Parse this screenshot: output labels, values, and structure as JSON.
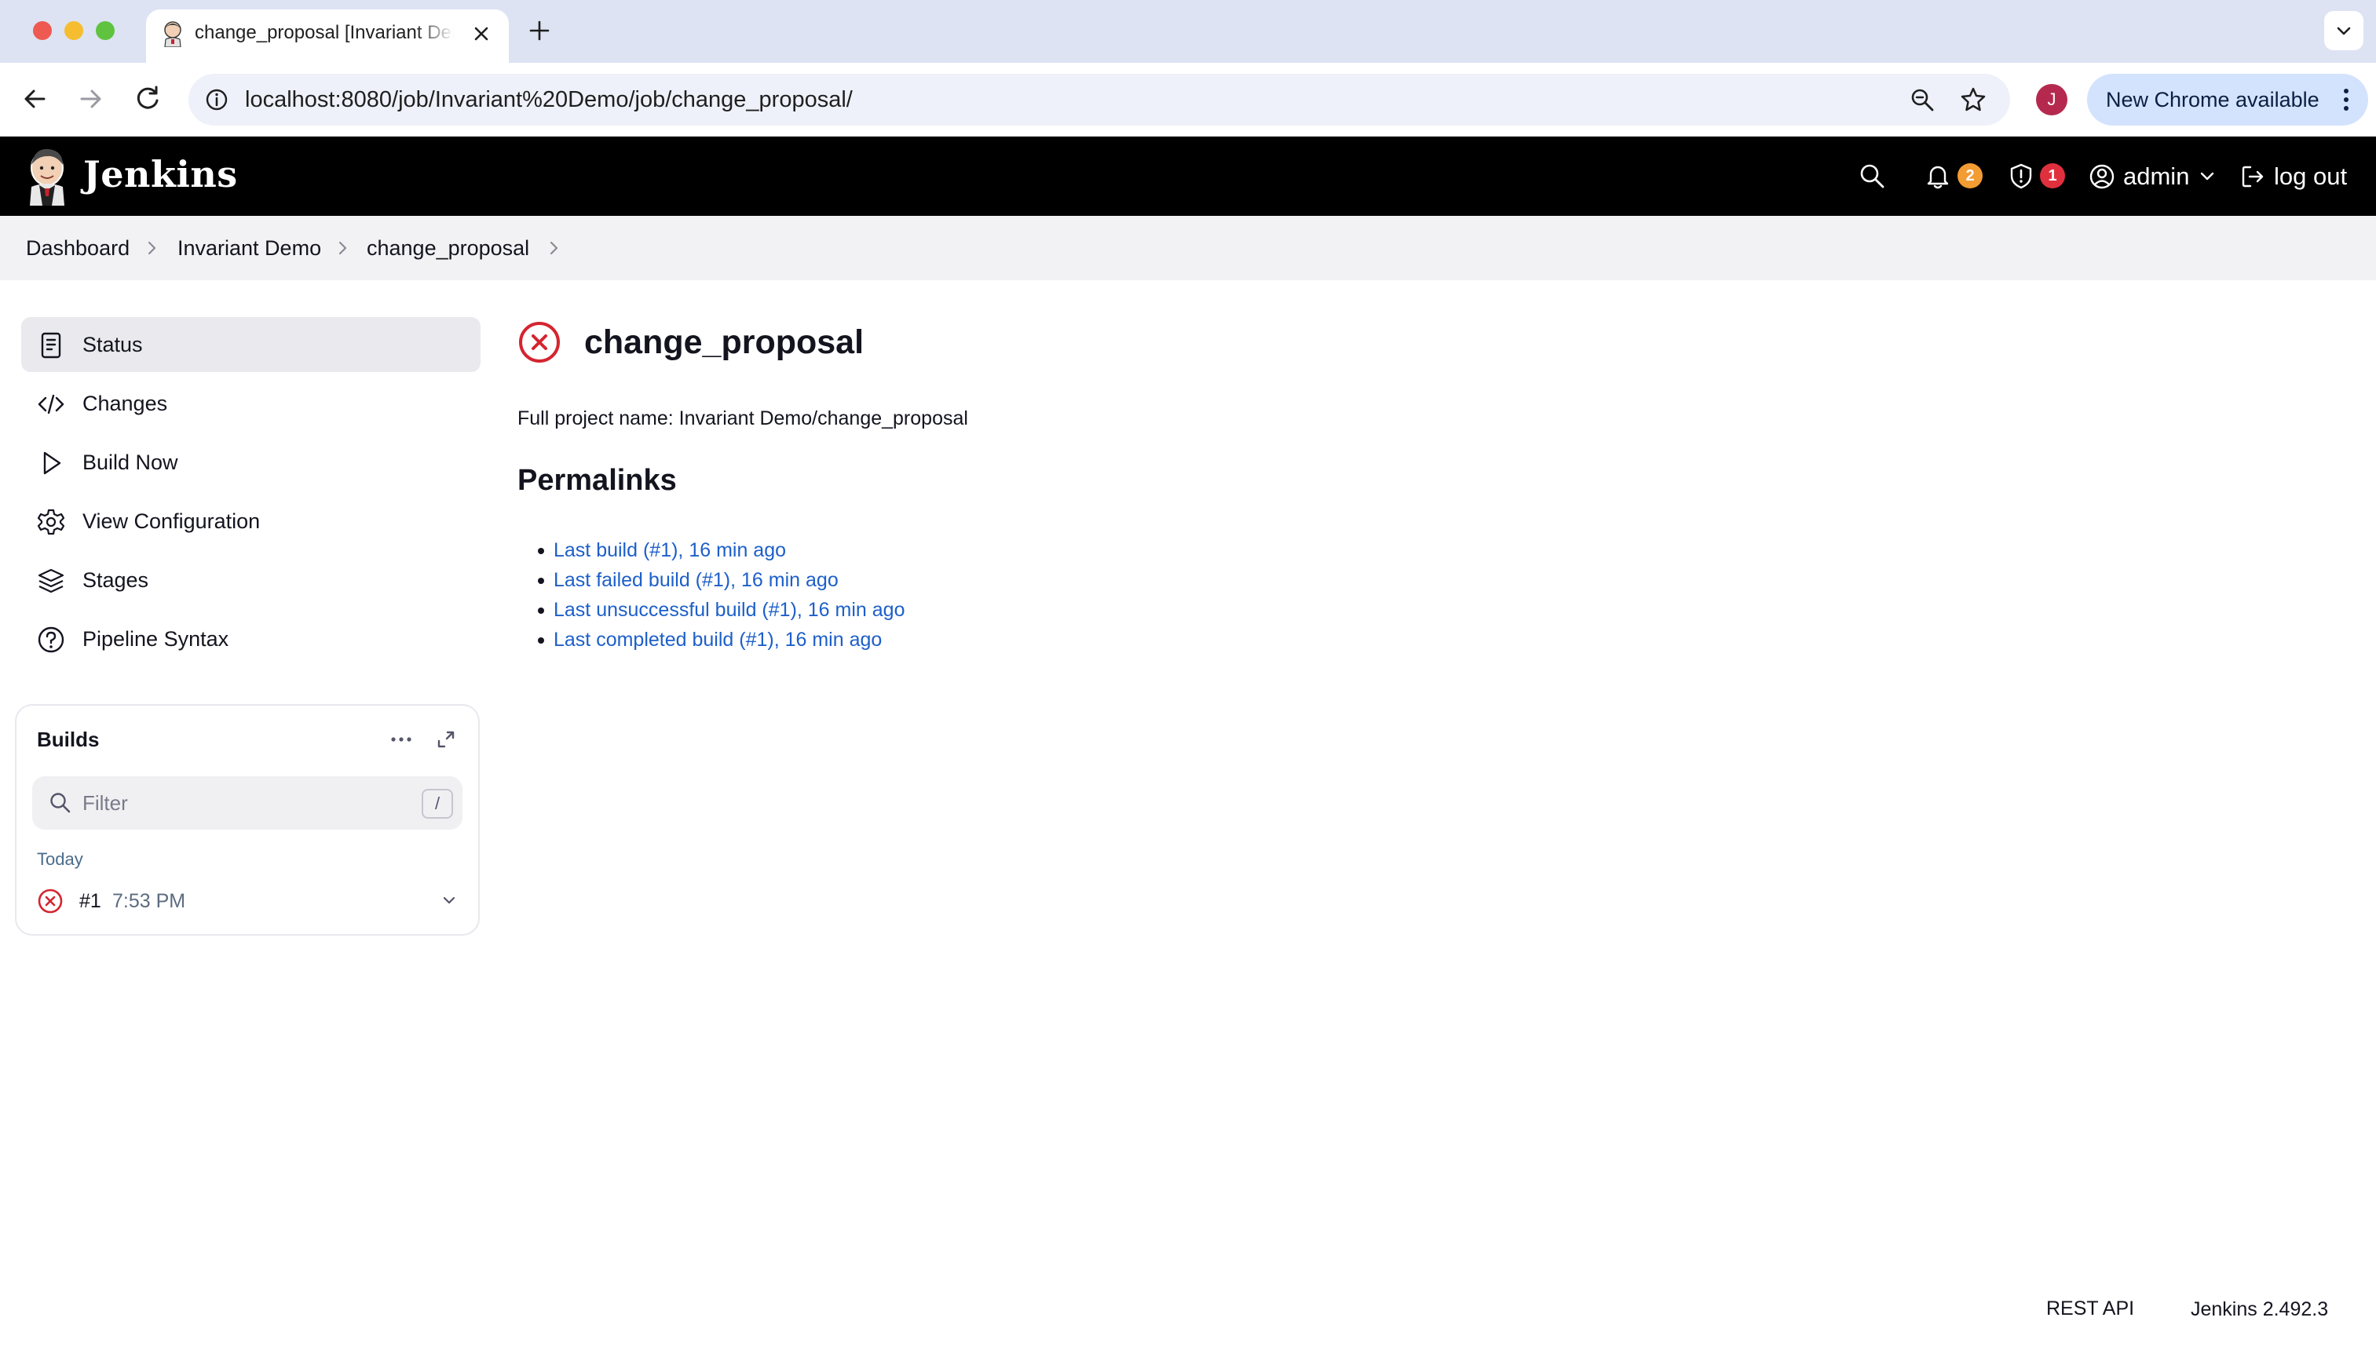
{
  "browser": {
    "tab_title": "change_proposal [Invariant Demo] [Jenkins]",
    "url": "localhost:8080/job/Invariant%20Demo/job/change_proposal/",
    "profile_initial": "J",
    "update_label": "New Chrome available"
  },
  "header": {
    "app_name": "Jenkins",
    "notifications_count": "2",
    "security_count": "1",
    "user": "admin",
    "logout": "log out"
  },
  "breadcrumb": [
    "Dashboard",
    "Invariant Demo",
    "change_proposal"
  ],
  "sidebar": {
    "items": [
      {
        "label": "Status",
        "icon": "status-doc-icon",
        "active": true
      },
      {
        "label": "Changes",
        "icon": "code-icon"
      },
      {
        "label": "Build Now",
        "icon": "play-icon"
      },
      {
        "label": "View Configuration",
        "icon": "gear-icon"
      },
      {
        "label": "Stages",
        "icon": "layers-icon"
      },
      {
        "label": "Pipeline Syntax",
        "icon": "help-icon"
      }
    ]
  },
  "builds": {
    "title": "Builds",
    "filter_placeholder": "Filter",
    "filter_key": "/",
    "group": "Today",
    "items": [
      {
        "number": "#1",
        "time": "7:53 PM",
        "status": "failed"
      }
    ]
  },
  "main": {
    "title": "change_proposal",
    "full_name": "Full project name: Invariant Demo/change_proposal",
    "permalinks_heading": "Permalinks",
    "permalinks": [
      "Last build (#1), 16 min ago",
      "Last failed build (#1), 16 min ago",
      "Last unsuccessful build (#1), 16 min ago",
      "Last completed build (#1), 16 min ago"
    ]
  },
  "footer": {
    "rest_api": "REST API",
    "version": "Jenkins 2.492.3"
  },
  "colors": {
    "header_bg": "#000000",
    "link": "#1d5fc9",
    "failed": "#d4252f",
    "badge_notifications": "#f39c33",
    "badge_security": "#e0303e"
  }
}
